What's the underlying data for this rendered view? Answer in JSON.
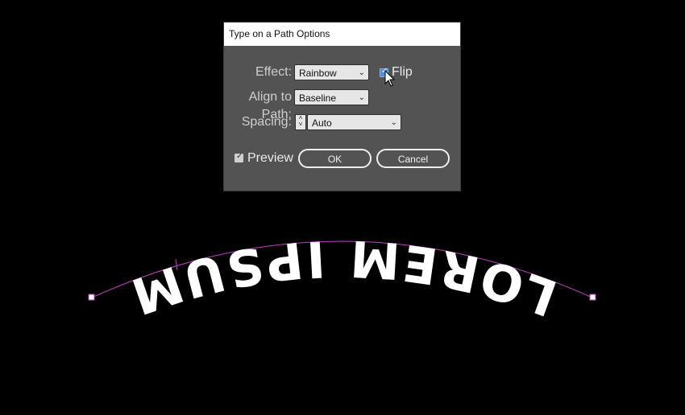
{
  "dialog": {
    "title": "Type on a Path Options",
    "effect_label": "Effect:",
    "effect_value": "Rainbow",
    "flip_label": "Flip",
    "flip_checked": true,
    "align_label": "Align to Path:",
    "align_value": "Baseline",
    "spacing_label": "Spacing:",
    "spacing_value": "Auto",
    "preview_label": "Preview",
    "preview_checked": true,
    "ok_label": "OK",
    "cancel_label": "Cancel"
  },
  "artwork": {
    "text": "LOREM IPSUM",
    "path_color": "#c040c0",
    "text_color": "#ffffff"
  },
  "colors": {
    "dialog_bg": "#535353",
    "canvas_bg": "#000000",
    "accent": "#4a90e2"
  }
}
